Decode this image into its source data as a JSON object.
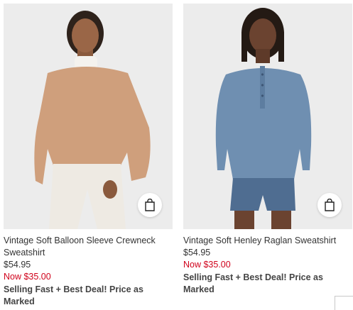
{
  "products": [
    {
      "name": "Vintage Soft Balloon Sleeve Crewneck Sweatshirt",
      "price": "$54.95",
      "sale_price": "Now $35.00",
      "badge": "Selling Fast + Best Deal! Price as Marked",
      "sweater_color": "#cf9f7c",
      "bottom_color": "#eeeae3",
      "quick_add_icon": "shopping-bag-icon"
    },
    {
      "name": "Vintage Soft Henley Raglan Sweatshirt",
      "price": "$54.95",
      "sale_price": "Now $35.00",
      "badge": "Selling Fast + Best Deal! Price as Marked",
      "sweater_color": "#6f8fb1",
      "bottom_color": "#4f6d91",
      "quick_add_icon": "shopping-bag-icon"
    }
  ],
  "colors": {
    "sale": "#d0021b",
    "text": "#333333",
    "photo_background": "#ececec"
  }
}
